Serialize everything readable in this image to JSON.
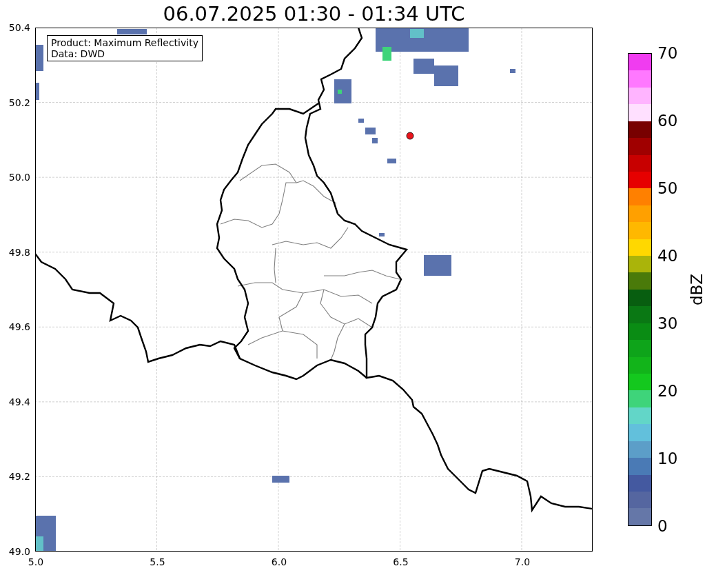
{
  "title": "06.07.2025 01:30 - 01:34 UTC",
  "map": {
    "legend": [
      "Product: Maximum Reflectivity",
      "Data: DWD"
    ],
    "xticks": [
      "5.0",
      "5.5",
      "6.0",
      "6.5",
      "7.0"
    ],
    "yticks": [
      "50.4",
      "50.2",
      "50.0",
      "49.8",
      "49.6",
      "49.4",
      "49.2",
      "49.0"
    ]
  },
  "colorbar": {
    "label": "dBZ",
    "ticks": [
      "70",
      "60",
      "50",
      "40",
      "30",
      "20",
      "10",
      "0"
    ],
    "segments": [
      {
        "color": "#f03cf0"
      },
      {
        "color": "#ff78ff"
      },
      {
        "color": "#ffb4ff"
      },
      {
        "color": "#ffe0ff"
      },
      {
        "color": "#780000"
      },
      {
        "color": "#a00000"
      },
      {
        "color": "#c80000"
      },
      {
        "color": "#e60000"
      },
      {
        "color": "#ff8000"
      },
      {
        "color": "#ffa000"
      },
      {
        "color": "#ffb800"
      },
      {
        "color": "#ffd800"
      },
      {
        "color": "#aab40a"
      },
      {
        "color": "#4a7a0a"
      },
      {
        "color": "#085e10"
      },
      {
        "color": "#0a7814"
      },
      {
        "color": "#0a8c14"
      },
      {
        "color": "#0ea41a"
      },
      {
        "color": "#12b41a"
      },
      {
        "color": "#14c81e"
      },
      {
        "color": "#3ed47a"
      },
      {
        "color": "#62d6c8"
      },
      {
        "color": "#62c0dc"
      },
      {
        "color": "#5c9ec8"
      },
      {
        "color": "#4a7ab5"
      },
      {
        "color": "#4459a0"
      },
      {
        "color": "#5566a0"
      },
      {
        "color": "#6577a8"
      }
    ]
  }
}
